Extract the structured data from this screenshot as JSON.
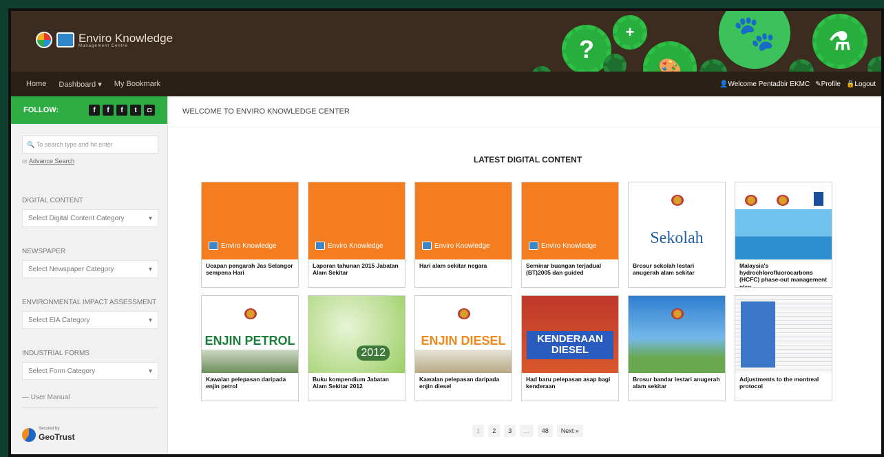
{
  "header": {
    "logo_title": "Enviro Knowledge",
    "logo_sub": "Management Centre"
  },
  "nav": {
    "home": "Home",
    "dashboard": "Dashboard",
    "bookmark": "My Bookmark",
    "welcome_user": "Welcome Pentadbir EKMC",
    "profile": "Profile",
    "logout": "Logout"
  },
  "sidebar": {
    "follow": "FOLLOW:",
    "search_placeholder": "To search type and hit enter",
    "or": "or",
    "advance_search": "Advance Search",
    "sections": [
      {
        "title": "DIGITAL CONTENT",
        "select": "Select Digital Content Category"
      },
      {
        "title": "NEWSPAPER",
        "select": "Select Newspaper Category"
      },
      {
        "title": "ENVIRONMENTAL IMPACT ASSESSMENT",
        "select": "Select EIA Category"
      },
      {
        "title": "INDUSTRIAL FORMS",
        "select": "Select Form Category"
      }
    ],
    "user_manual": "User Manual",
    "geotrust_small": "Secured by",
    "geotrust": "GeoTrust"
  },
  "main": {
    "welcome": "WELCOME TO ENVIRO KNOWLEDGE CENTER",
    "latest": "LATEST DIGITAL CONTENT",
    "cards": [
      {
        "caption": "Ucapan pengarah Jas Selangor sempena Hari",
        "thumb_label": "Enviro Knowledge"
      },
      {
        "caption": "Laporan tahunan 2015 Jabatan Alam Sekitar",
        "thumb_label": "Enviro Knowledge"
      },
      {
        "caption": "Hari alam sekitar negara",
        "thumb_label": "Enviro Knowledge"
      },
      {
        "caption": "Seminar buangan terjadual (BT)2005 dan guided",
        "thumb_label": "Enviro Knowledge"
      },
      {
        "caption": "Brosur sekolah lestari anugerah alam sekitar",
        "thumb_label": "Sekolah"
      },
      {
        "caption": "Malaysia's hydrochlorofluorocarbons (HCFC) phase-out management plan",
        "thumb_label": ""
      },
      {
        "caption": "Kawalan pelepasan daripada enjin petrol",
        "thumb_label": "ENJIN PETROL"
      },
      {
        "caption": "Buku kompendium Jabatan Alam Sekitar 2012",
        "thumb_label": "2012"
      },
      {
        "caption": "Kawalan pelepasan daripada enjin diesel",
        "thumb_label": "ENJIN DIESEL"
      },
      {
        "caption": "Had baru pelepasan asap bagi kenderaan",
        "thumb_label": "KENDERAAN DIESEL"
      },
      {
        "caption": "Brosur bandar lestari anugerah alam sekitar",
        "thumb_label": ""
      },
      {
        "caption": "Adjustments to the montreal protocol",
        "thumb_label": ""
      }
    ],
    "pager": [
      "1",
      "2",
      "3",
      "...",
      "48",
      "Next »"
    ]
  },
  "colors": {
    "header_bg": "#3b2c1f",
    "green": "#2eac44",
    "orange": "#f47d20"
  }
}
